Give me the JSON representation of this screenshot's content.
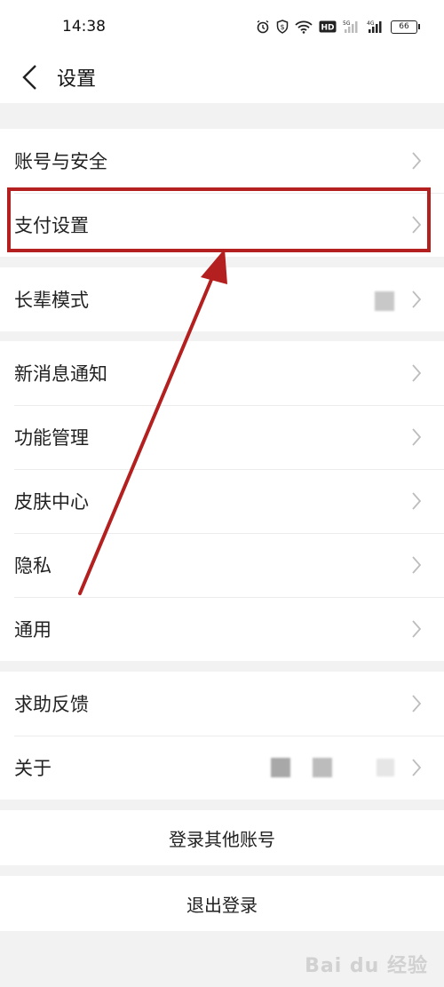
{
  "status_bar": {
    "time": "14:38",
    "icons": [
      "alarm-icon",
      "shield-icon",
      "wifi-icon",
      "hd-icon",
      "signal-5g-icon",
      "signal-4g-icon"
    ],
    "battery_level": "66"
  },
  "nav": {
    "title": "设置"
  },
  "sections": [
    {
      "items": [
        {
          "label": "账号与安全"
        },
        {
          "label": "支付设置"
        }
      ]
    },
    {
      "items": [
        {
          "label": "长辈模式"
        }
      ]
    },
    {
      "items": [
        {
          "label": "新消息通知"
        },
        {
          "label": "功能管理"
        },
        {
          "label": "皮肤中心"
        },
        {
          "label": "隐私"
        },
        {
          "label": "通用"
        }
      ]
    },
    {
      "items": [
        {
          "label": "求助反馈"
        },
        {
          "label": "关于"
        }
      ]
    }
  ],
  "actions": {
    "switch_account": "登录其他账号",
    "logout": "退出登录"
  },
  "annotation": {
    "highlight_color": "#b3201f"
  },
  "watermark": {
    "text": "Bai du 经验"
  }
}
